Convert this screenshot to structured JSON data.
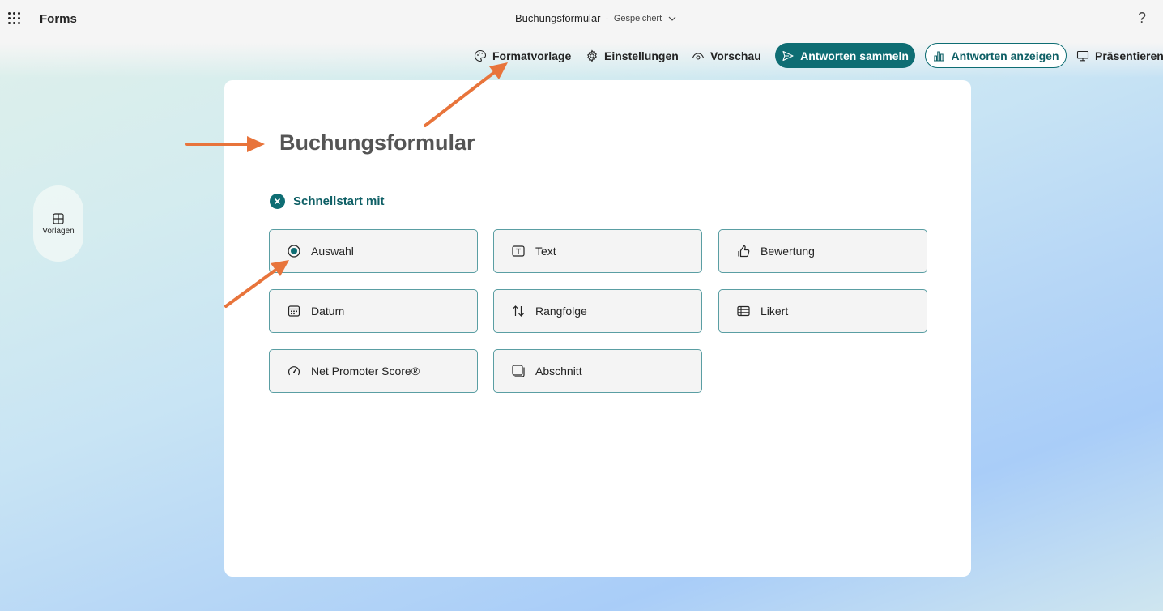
{
  "app": {
    "name": "Forms"
  },
  "document": {
    "title": "Buchungsformular",
    "separator": "-",
    "status": "Gespeichert"
  },
  "help_label": "?",
  "toolbar": {
    "theme_label": "Formatvorlage",
    "settings_label": "Einstellungen",
    "preview_label": "Vorschau",
    "collect_label": "Antworten sammeln",
    "view_label": "Antworten anzeigen",
    "present_label": "Präsentieren"
  },
  "sidebar": {
    "templates_label": "Vorlagen"
  },
  "form": {
    "title": "Buchungsformular",
    "quickstart_label": "Schnellstart mit",
    "question_types": [
      {
        "label": "Auswahl",
        "icon": "radio-icon"
      },
      {
        "label": "Text",
        "icon": "text-box-icon"
      },
      {
        "label": "Bewertung",
        "icon": "thumbs-up-icon"
      },
      {
        "label": "Datum",
        "icon": "calendar-icon"
      },
      {
        "label": "Rangfolge",
        "icon": "sort-arrows-icon"
      },
      {
        "label": "Likert",
        "icon": "likert-grid-icon"
      },
      {
        "label": "Net Promoter Score®",
        "icon": "gauge-icon"
      },
      {
        "label": "Abschnitt",
        "icon": "section-icon"
      }
    ]
  },
  "colors": {
    "accent": "#0e6d73",
    "annotation": "#e8743b",
    "card": "#ffffff"
  }
}
